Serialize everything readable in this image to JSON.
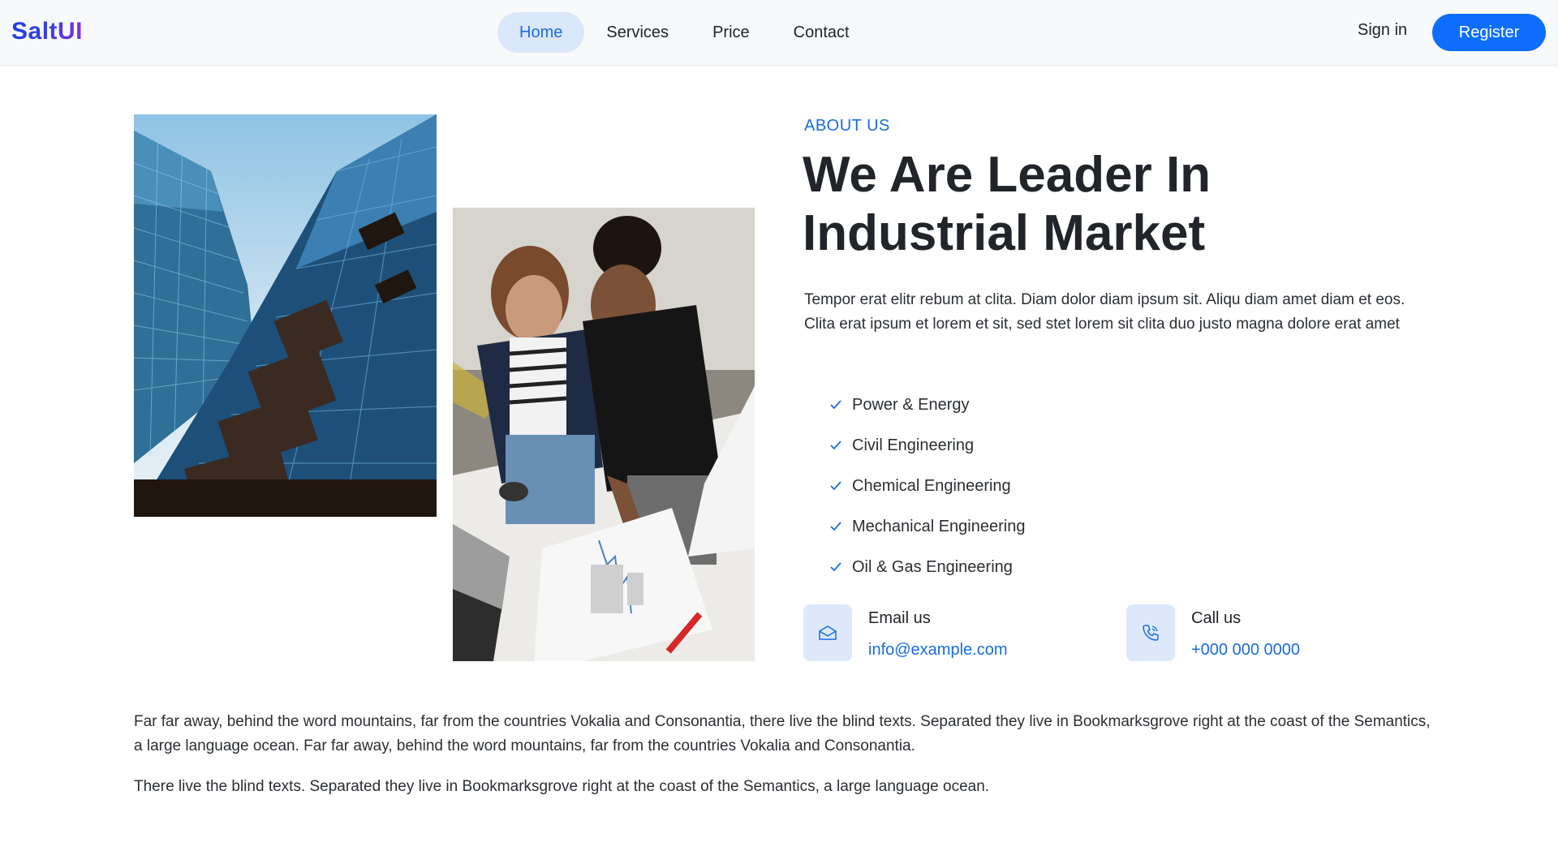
{
  "header": {
    "logo": "SaltUI",
    "nav": [
      {
        "label": "Home",
        "active": true
      },
      {
        "label": "Services",
        "active": false
      },
      {
        "label": "Price",
        "active": false
      },
      {
        "label": "Contact",
        "active": false
      }
    ],
    "signin_label": "Sign in",
    "register_label": "Register"
  },
  "about": {
    "eyebrow": "ABOUT US",
    "title_line1": "We Are Leader In",
    "title_line2": "Industrial Market",
    "lead": "Tempor erat elitr rebum at clita. Diam dolor diam ipsum sit. Aliqu diam amet diam et eos. Clita erat ipsum et lorem et sit, sed stet lorem sit clita duo justo magna dolore erat amet",
    "features": [
      "Power & Energy",
      "Civil Engineering",
      "Chemical Engineering",
      "Mechanical Engineering",
      "Oil & Gas Engineering"
    ],
    "email": {
      "label": "Email us",
      "value": "info@example.com",
      "icon": "envelope-icon"
    },
    "call": {
      "label": "Call us",
      "value": "+000 000 0000",
      "icon": "phone-icon"
    }
  },
  "body": {
    "paragraph1": "Far far away, behind the word mountains, far from the countries Vokalia and Consonantia, there live the blind texts. Separated they live in Bookmarksgrove right at the coast of the Semantics, a large language ocean. Far far away, behind the word mountains, far from the countries Vokalia and Consonantia.",
    "paragraph2": "There live the blind texts. Separated they live in Bookmarksgrove right at the coast of the Semantics, a large language ocean."
  },
  "colors": {
    "accent": "#0d6efd",
    "link": "#1a6ce0",
    "active_nav_bg": "#dbe7fa",
    "icon_tile_bg": "#dde9fb",
    "header_bg": "#f8f9fa"
  }
}
